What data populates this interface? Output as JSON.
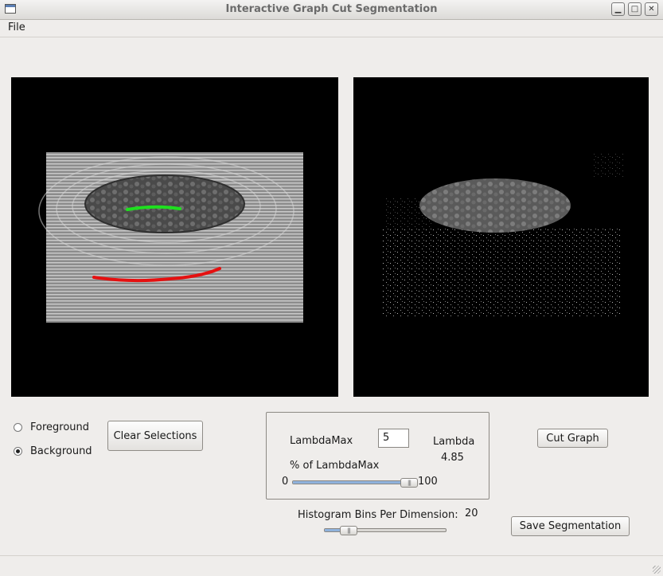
{
  "window": {
    "title": "Interactive Graph Cut Segmentation",
    "controls": [
      "minimize-icon",
      "maximize-icon",
      "close-icon"
    ]
  },
  "menu": {
    "file": "File"
  },
  "panels": {
    "input_image": "grayscale zen garden image with green foreground stroke and red background stroke",
    "output_image": "segmented result showing the moss mound on black background"
  },
  "selection": {
    "foreground_label": "Foreground",
    "background_label": "Background",
    "selected": "Background",
    "clear_label": "Clear Selections"
  },
  "lambda": {
    "max_label": "LambdaMax",
    "max_value": "5",
    "lambda_label": "Lambda",
    "lambda_value": "4.85",
    "percent_label": "% of LambdaMax",
    "slider_min": "0",
    "slider_max": "100",
    "slider_percent": 97
  },
  "histogram": {
    "label": "Histogram Bins Per Dimension:",
    "value": "20",
    "slider_fraction": 0.2
  },
  "actions": {
    "cut_label": "Cut Graph",
    "save_label": "Save Segmentation"
  },
  "colors": {
    "foreground_stroke": "#1ee01e",
    "background_stroke": "#e51010",
    "slider_fill": "#8fb2dc"
  }
}
